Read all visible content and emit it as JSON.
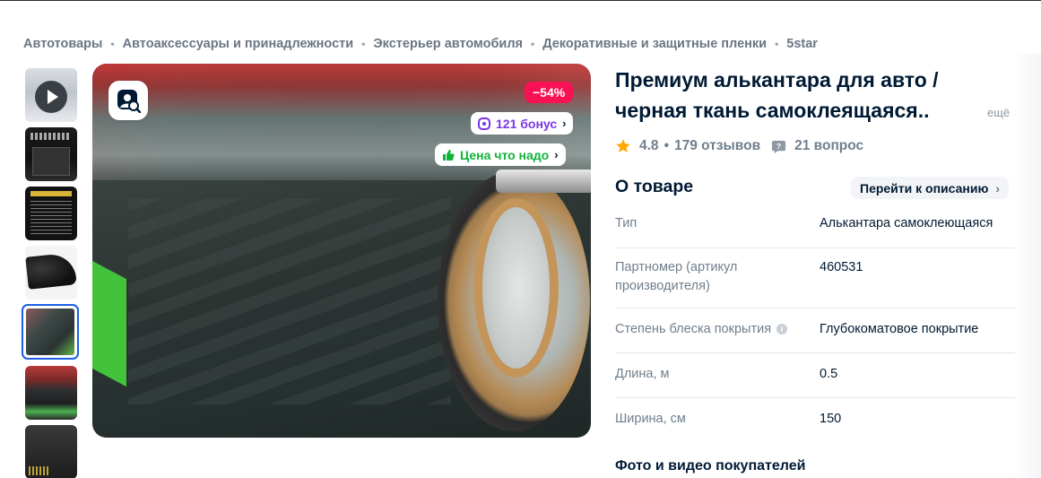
{
  "breadcrumbs": [
    "Автотовары",
    "Автоаксессуары и принадлежности",
    "Экстерьер автомобиля",
    "Декоративные и защитные пленки",
    "5star"
  ],
  "gallery": {
    "thumbnails": [
      "video-preview",
      "instruction-card",
      "size-chart",
      "black-fabric-roll",
      "roll-closeup",
      "roll-machine",
      "packaging"
    ],
    "active_index": 4
  },
  "badges": {
    "discount": "−54%",
    "bonus": "121 бонус",
    "good_price": "Цена что надо"
  },
  "product": {
    "title_line1": "Премиум алькантара для авто /",
    "title_line2": "черная ткань самоклеящаяся..",
    "more_label": "ещё",
    "rating": "4.8",
    "reviews": "179 отзывов",
    "questions": "21 вопрос"
  },
  "about": {
    "heading": "О товаре",
    "to_description": "Перейти к описанию",
    "specs": [
      {
        "key": "Тип",
        "value": "Алькантара самоклеющаяся"
      },
      {
        "key": "Партномер (артикул производителя)",
        "value": "460531"
      },
      {
        "key": "Степень блеска покрытия",
        "value": "Глубокоматовое покрытие",
        "info": "i"
      },
      {
        "key": "Длина, м",
        "value": "0.5"
      },
      {
        "key": "Ширина, см",
        "value": "150"
      }
    ]
  },
  "photos_heading": "Фото и видео покупателей",
  "colors": {
    "discount_bg": "#f91155",
    "bonus_text": "#7a34e8",
    "good_price_text": "#10b33a",
    "active_thumb_border": "#1c5fe6",
    "star": "#ffa800"
  }
}
